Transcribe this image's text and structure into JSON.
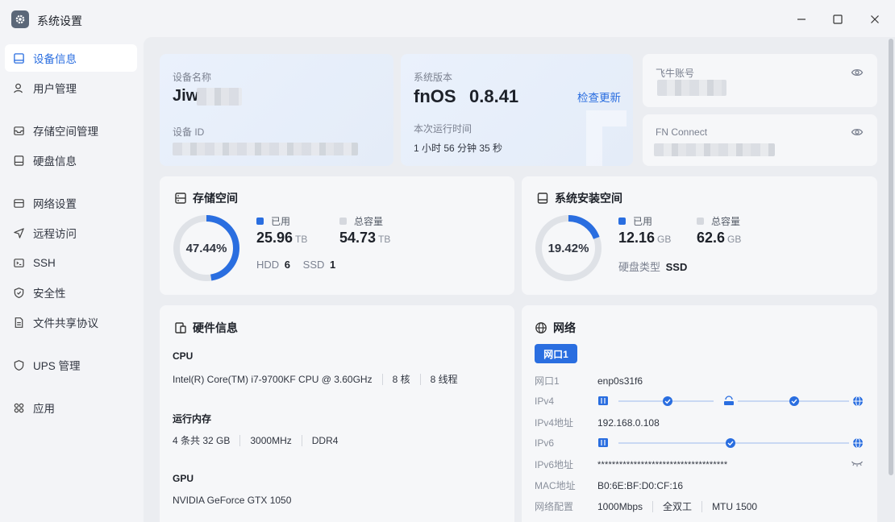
{
  "window": {
    "title": "系统设置",
    "controls": [
      "minimize",
      "maximize",
      "close"
    ]
  },
  "sidebar": {
    "items": [
      {
        "label": "设备信息",
        "icon": "monitor-icon",
        "active": true
      },
      {
        "label": "用户管理",
        "icon": "user-icon"
      },
      {
        "label": "存储空间管理",
        "icon": "storage-icon"
      },
      {
        "label": "硬盘信息",
        "icon": "disk-icon"
      },
      {
        "label": "网络设置",
        "icon": "network-icon"
      },
      {
        "label": "远程访问",
        "icon": "send-icon"
      },
      {
        "label": "SSH",
        "icon": "terminal-icon"
      },
      {
        "label": "安全性",
        "icon": "shield-icon"
      },
      {
        "label": "文件共享协议",
        "icon": "file-icon"
      },
      {
        "label": "UPS 管理",
        "icon": "ups-shield-icon"
      },
      {
        "label": "应用",
        "icon": "apps-icon"
      }
    ]
  },
  "device": {
    "name_label": "设备名称",
    "name_value": "Jiw",
    "id_label": "设备 ID"
  },
  "system": {
    "version_label": "系统版本",
    "os_name": "fnOS",
    "os_version": "0.8.41",
    "check_update": "检查更新",
    "uptime_label": "本次运行时间",
    "uptime_value": "1 小时 56 分钟 35 秒"
  },
  "account": {
    "feiniu_label": "飞牛账号",
    "fnconnect_label": "FN Connect"
  },
  "storage": {
    "title": "存储空间",
    "percent": "47.44%",
    "used_label": "已用",
    "used_value": "25.96",
    "used_unit": "TB",
    "total_label": "总容量",
    "total_value": "54.73",
    "total_unit": "TB",
    "hdd_label": "HDD",
    "hdd_count": "6",
    "ssd_label": "SSD",
    "ssd_count": "1"
  },
  "sysdisk": {
    "title": "系统安装空间",
    "percent": "19.42%",
    "used_label": "已用",
    "used_value": "12.16",
    "used_unit": "GB",
    "total_label": "总容量",
    "total_value": "62.6",
    "total_unit": "GB",
    "disk_type_label": "硬盘类型",
    "disk_type_value": "SSD"
  },
  "chart_data": [
    {
      "type": "pie",
      "categories": [
        "已用",
        "总容量"
      ],
      "values": [
        47.44,
        52.56
      ]
    },
    {
      "type": "pie",
      "categories": [
        "已用",
        "总容量"
      ],
      "values": [
        19.42,
        80.58
      ]
    }
  ],
  "hardware": {
    "title": "硬件信息",
    "cpu_label": "CPU",
    "cpu_model": "Intel(R) Core(TM) i7-9700KF CPU @ 3.60GHz",
    "cpu_cores": "8 核",
    "cpu_threads": "8 线程",
    "mem_label": "运行内存",
    "mem_size": "4 条共 32 GB",
    "mem_speed": "3000MHz",
    "mem_type": "DDR4",
    "gpu_label": "GPU",
    "gpu_model": "NVIDIA GeForce GTX 1050"
  },
  "network": {
    "title": "网络",
    "tab": "网口1",
    "port_label": "网口1",
    "port_value": "enp0s31f6",
    "ipv4_label": "IPv4",
    "ipv4_addr_label": "IPv4地址",
    "ipv4_addr": "192.168.0.108",
    "ipv6_label": "IPv6",
    "ipv6_addr_label": "IPv6地址",
    "ipv6_addr": "************************************",
    "mac_label": "MAC地址",
    "mac_value": "B0:6E:BF:D0:CF:16",
    "config_label": "网络配置",
    "config_speed": "1000Mbps",
    "config_duplex": "全双工",
    "config_mtu": "MTU 1500"
  },
  "colors": {
    "accent": "#2a6ee0",
    "ring_track": "#dfe2e7",
    "total_swatch": "#d5d8de"
  }
}
